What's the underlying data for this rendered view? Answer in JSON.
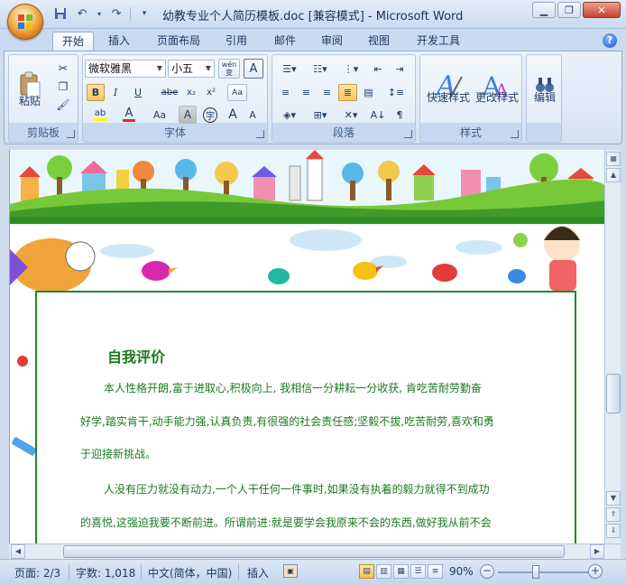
{
  "window": {
    "title": "幼教专业个人简历模板.doc [兼容模式] - Microsoft Word"
  },
  "quick_access": {
    "icons": [
      "save-icon",
      "undo-icon",
      "redo-icon",
      "customize-icon"
    ]
  },
  "tabs": [
    {
      "label": "开始",
      "active": true
    },
    {
      "label": "插入"
    },
    {
      "label": "页面布局"
    },
    {
      "label": "引用"
    },
    {
      "label": "邮件"
    },
    {
      "label": "审阅"
    },
    {
      "label": "视图"
    },
    {
      "label": "开发工具"
    }
  ],
  "ribbon": {
    "clipboard": {
      "label": "剪贴板",
      "paste_label": "粘贴"
    },
    "font": {
      "label": "字体",
      "font_name": "微软雅黑",
      "font_size": "小五",
      "phonetic": "wén 变",
      "border_char": "A",
      "bold": "B",
      "italic": "I",
      "underline": "U",
      "strike": "abe",
      "subscript": "x₂",
      "superscript": "x²",
      "clear_format": "Aa",
      "change_case": "Aa",
      "shade_char": "A",
      "circle_char": "字",
      "grow_font": "A",
      "shrink_font": "A"
    },
    "paragraph": {
      "label": "段落"
    },
    "styles": {
      "label": "样式",
      "quick_styles": "快速样式",
      "change_styles": "更改样式"
    },
    "editing": {
      "label": "编辑"
    }
  },
  "document": {
    "heading": "自我评价",
    "lines": [
      "本人性格开朗,富于进取心,积极向上,  我相信一分耕耘一分收获,  肯吃苦耐劳勤奋",
      "好学,踏实肯干,动手能力强,认真负责,有很强的社会责任感;坚毅不拔,吃苦耐劳,喜欢和勇",
      "于迎接新挑战。",
      "人没有压力就没有动力,一个人干任何一件事时,如果没有执着的毅力就得不到成功",
      "的喜悦,这强迫我要不断前进。所谓前进:就是要学会我原来不会的东西,做好我从前不会"
    ]
  },
  "status": {
    "page": "页面: 2/3",
    "words": "字数: 1,018",
    "language": "中文(简体，中国)",
    "mode": "插入",
    "zoom": "90%"
  },
  "colors": {
    "doc_text": "#1b7a20",
    "frame": "#1e8a2a"
  }
}
